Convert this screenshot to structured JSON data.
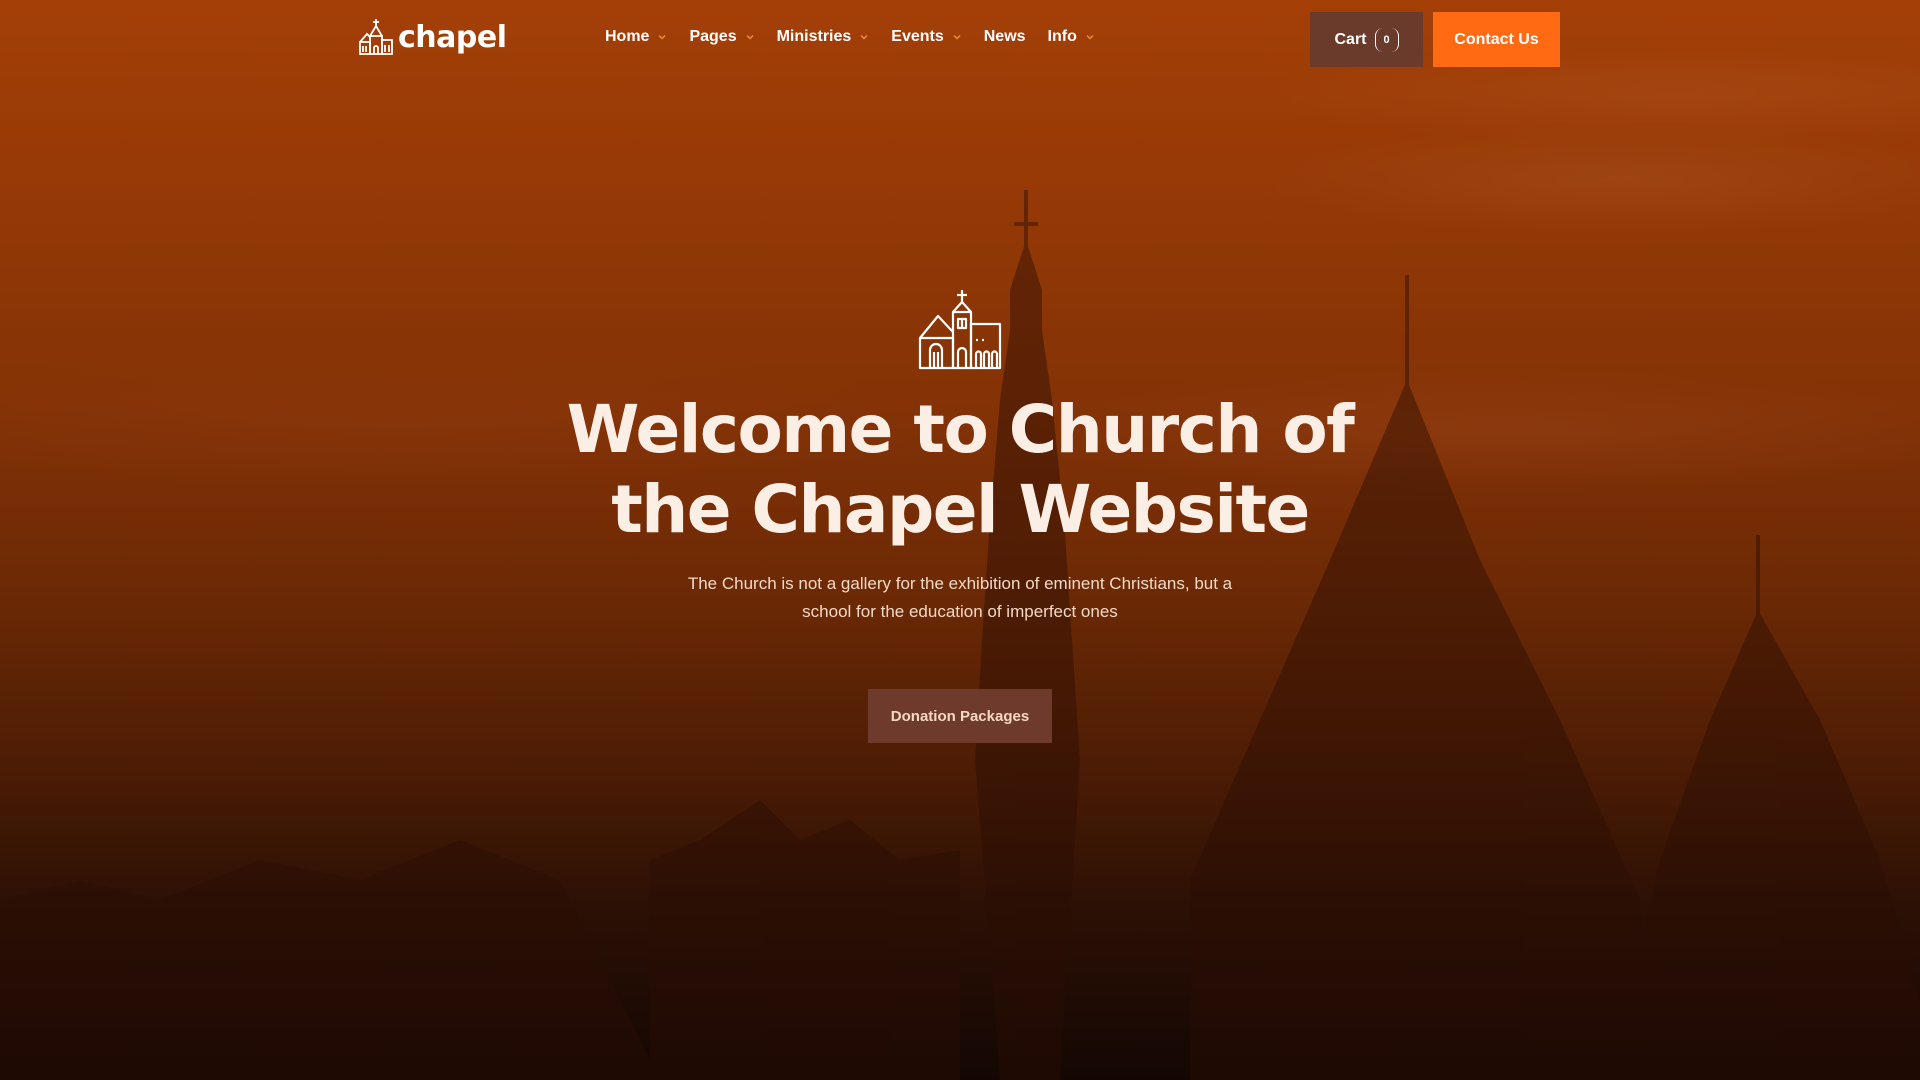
{
  "brand": {
    "name": "chapel",
    "logo_icon": "church-icon"
  },
  "nav": {
    "items": [
      {
        "label": "Home",
        "has_dropdown": true
      },
      {
        "label": "Pages",
        "has_dropdown": true
      },
      {
        "label": "Ministries",
        "has_dropdown": true
      },
      {
        "label": "Events",
        "has_dropdown": true
      },
      {
        "label": "News",
        "has_dropdown": false
      },
      {
        "label": "Info",
        "has_dropdown": true
      }
    ]
  },
  "header_actions": {
    "cart_label": "Cart",
    "cart_count": "0",
    "contact_label": "Contact Us"
  },
  "hero": {
    "icon": "church-icon",
    "title": "Welcome to Church of the Chapel Website",
    "subtitle": "The Church is not a gallery for the exhibition of eminent Christians, but a school for the education of imperfect ones",
    "cta_label": "Donation Packages"
  },
  "colors": {
    "accent": "#ff6a13",
    "dropdown_chevron": "#f08a3c",
    "button_dark": "#6a3a2a",
    "hero_top": "#a43f07",
    "hero_bottom": "#140703"
  }
}
